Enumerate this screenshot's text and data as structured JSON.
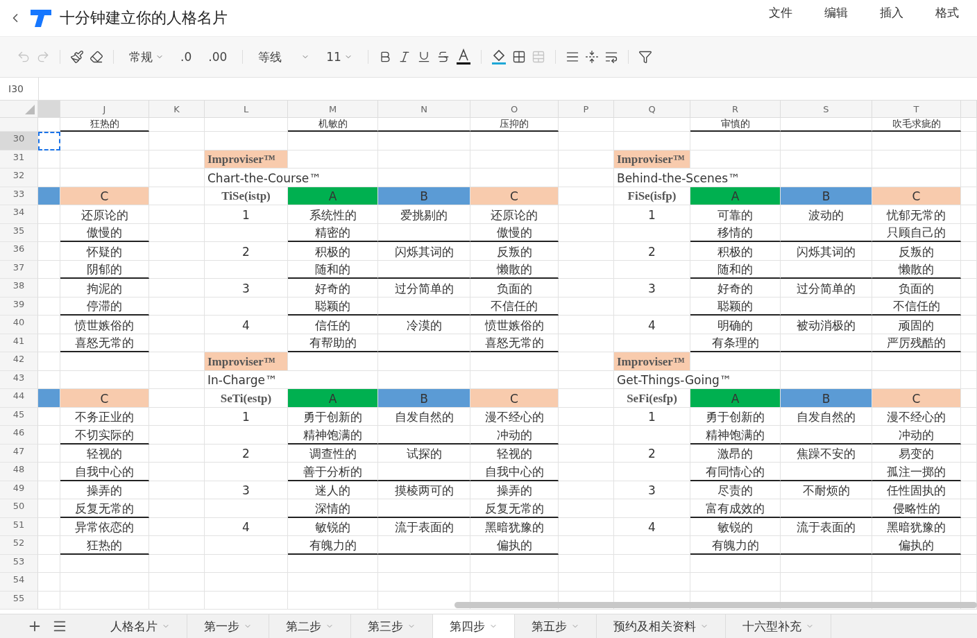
{
  "app": {
    "title": "十分钟建立你的人格名片",
    "menu": [
      {
        "label": "文件"
      },
      {
        "label": "编辑"
      },
      {
        "label": "插入"
      },
      {
        "label": "格式"
      }
    ]
  },
  "toolbar": {
    "number_format": "常规",
    "decrease_decimal": ".0",
    "increase_decimal": ".00",
    "font": "等线",
    "font_size": "11"
  },
  "formula_bar": {
    "cell_ref": "I30"
  },
  "columns": [
    {
      "selected": true
    },
    {
      "label": "J",
      "selected": false
    },
    {
      "label": "K",
      "selected": false
    },
    {
      "label": "L",
      "selected": false
    },
    {
      "label": "M",
      "selected": false
    },
    {
      "label": "N",
      "selected": false
    },
    {
      "label": "O",
      "selected": false
    },
    {
      "label": "P",
      "selected": false
    },
    {
      "label": "Q",
      "selected": false
    },
    {
      "label": "R",
      "selected": false
    },
    {
      "label": "S",
      "selected": false
    },
    {
      "label": "T",
      "selected": false
    },
    {
      "selected": false
    }
  ],
  "rows": [
    {
      "selected": false,
      "divider": true,
      "cells": [
        {
          "kind": "blank"
        },
        {
          "kind": "text",
          "text": "狂热的"
        },
        {
          "kind": "blank"
        },
        {
          "kind": "blank"
        },
        {
          "kind": "text",
          "text": "机敏的"
        },
        {
          "kind": "blank"
        },
        {
          "kind": "text",
          "text": "压抑的"
        },
        {
          "kind": "blank"
        },
        {
          "kind": "blank"
        },
        {
          "kind": "text",
          "text": "审慎的"
        },
        {
          "kind": "blank"
        },
        {
          "kind": "text",
          "text": "吹毛求疵的"
        }
      ]
    },
    {
      "number": "30",
      "selected": true,
      "divider": false,
      "cells": [
        {
          "kind": "blank"
        }
      ]
    },
    {
      "number": "31",
      "selected": false,
      "divider": false,
      "cells": [
        {
          "kind": "blank"
        },
        {
          "kind": "blank"
        },
        {
          "kind": "blank"
        },
        {
          "kind": "title",
          "text": "Improviser™",
          "color": "#f8cbad"
        },
        {
          "kind": "blank"
        },
        {
          "kind": "blank"
        },
        {
          "kind": "blank"
        },
        {
          "kind": "blank"
        },
        {
          "kind": "title",
          "text": "Improviser™",
          "color": "#f8cbad"
        }
      ]
    },
    {
      "number": "32",
      "selected": false,
      "divider": false,
      "cells": [
        {
          "kind": "blank"
        },
        {
          "kind": "blank"
        },
        {
          "kind": "blank"
        },
        {
          "kind": "wide",
          "text": "Chart-the-Course™"
        },
        {
          "kind": "blank"
        },
        {
          "kind": "blank"
        },
        {
          "kind": "blank"
        },
        {
          "kind": "wide",
          "text": "Behind-the-Scenes™"
        }
      ]
    },
    {
      "number": "33",
      "selected": false,
      "divider": false,
      "cells": [
        {
          "kind": "fill",
          "color": "#5b9bd5"
        },
        {
          "kind": "text",
          "text": "C",
          "color": "#f8cbad"
        },
        {
          "kind": "blank"
        },
        {
          "kind": "code",
          "text": "TiSe(istp)"
        },
        {
          "kind": "text",
          "text": "A",
          "color": "#00b050"
        },
        {
          "kind": "text",
          "text": "B",
          "color": "#5b9bd5"
        },
        {
          "kind": "text",
          "text": "C",
          "color": "#f8cbad"
        },
        {
          "kind": "blank"
        },
        {
          "kind": "code",
          "text": "FiSe(isfp)"
        },
        {
          "kind": "text",
          "text": "A",
          "color": "#00b050"
        },
        {
          "kind": "text",
          "text": "B",
          "color": "#5b9bd5"
        },
        {
          "kind": "text",
          "text": "C",
          "color": "#f8cbad"
        }
      ]
    },
    {
      "number": "34",
      "selected": false,
      "divider": false,
      "cells": [
        {
          "kind": "blank"
        },
        {
          "kind": "text",
          "text": "还原论的"
        },
        {
          "kind": "blank"
        },
        {
          "kind": "text",
          "text": "1"
        },
        {
          "kind": "text",
          "text": "系统性的"
        },
        {
          "kind": "text",
          "text": "爱挑剔的"
        },
        {
          "kind": "text",
          "text": "还原论的"
        },
        {
          "kind": "blank"
        },
        {
          "kind": "text",
          "text": "1"
        },
        {
          "kind": "text",
          "text": "可靠的"
        },
        {
          "kind": "text",
          "text": "波动的"
        },
        {
          "kind": "text",
          "text": "忧郁无常的"
        }
      ]
    },
    {
      "number": "35",
      "selected": false,
      "divider": true,
      "cells": [
        {
          "kind": "blank"
        },
        {
          "kind": "text",
          "text": "傲慢的"
        },
        {
          "kind": "blank"
        },
        {
          "kind": "blank"
        },
        {
          "kind": "text",
          "text": "精密的"
        },
        {
          "kind": "blank"
        },
        {
          "kind": "text",
          "text": "傲慢的"
        },
        {
          "kind": "blank"
        },
        {
          "kind": "blank"
        },
        {
          "kind": "text",
          "text": "移情的"
        },
        {
          "kind": "blank"
        },
        {
          "kind": "text",
          "text": "只顾自己的"
        }
      ]
    },
    {
      "number": "36",
      "selected": false,
      "divider": false,
      "cells": [
        {
          "kind": "blank"
        },
        {
          "kind": "text",
          "text": "怀疑的"
        },
        {
          "kind": "blank"
        },
        {
          "kind": "text",
          "text": "2"
        },
        {
          "kind": "text",
          "text": "积极的"
        },
        {
          "kind": "text",
          "text": "闪烁其词的"
        },
        {
          "kind": "text",
          "text": "反叛的"
        },
        {
          "kind": "blank"
        },
        {
          "kind": "text",
          "text": "2"
        },
        {
          "kind": "text",
          "text": "积极的"
        },
        {
          "kind": "text",
          "text": "闪烁其词的"
        },
        {
          "kind": "text",
          "text": "反叛的"
        }
      ]
    },
    {
      "number": "37",
      "selected": false,
      "divider": true,
      "cells": [
        {
          "kind": "blank"
        },
        {
          "kind": "text",
          "text": "阴郁的"
        },
        {
          "kind": "blank"
        },
        {
          "kind": "blank"
        },
        {
          "kind": "text",
          "text": "随和的"
        },
        {
          "kind": "blank"
        },
        {
          "kind": "text",
          "text": "懒散的"
        },
        {
          "kind": "blank"
        },
        {
          "kind": "blank"
        },
        {
          "kind": "text",
          "text": "随和的"
        },
        {
          "kind": "blank"
        },
        {
          "kind": "text",
          "text": "懒散的"
        }
      ]
    },
    {
      "number": "38",
      "selected": false,
      "divider": false,
      "cells": [
        {
          "kind": "blank"
        },
        {
          "kind": "text",
          "text": "拘泥的"
        },
        {
          "kind": "blank"
        },
        {
          "kind": "text",
          "text": "3"
        },
        {
          "kind": "text",
          "text": "好奇的"
        },
        {
          "kind": "text",
          "text": "过分简单的"
        },
        {
          "kind": "text",
          "text": "负面的"
        },
        {
          "kind": "blank"
        },
        {
          "kind": "text",
          "text": "3"
        },
        {
          "kind": "text",
          "text": "好奇的"
        },
        {
          "kind": "text",
          "text": "过分简单的"
        },
        {
          "kind": "text",
          "text": "负面的"
        }
      ]
    },
    {
      "number": "39",
      "selected": false,
      "divider": true,
      "cells": [
        {
          "kind": "blank"
        },
        {
          "kind": "text",
          "text": "停滞的"
        },
        {
          "kind": "blank"
        },
        {
          "kind": "blank"
        },
        {
          "kind": "text",
          "text": "聪颖的"
        },
        {
          "kind": "blank"
        },
        {
          "kind": "text",
          "text": "不信任的"
        },
        {
          "kind": "blank"
        },
        {
          "kind": "blank"
        },
        {
          "kind": "text",
          "text": "聪颖的"
        },
        {
          "kind": "blank"
        },
        {
          "kind": "text",
          "text": "不信任的"
        }
      ]
    },
    {
      "number": "40",
      "selected": false,
      "divider": false,
      "cells": [
        {
          "kind": "blank"
        },
        {
          "kind": "text",
          "text": "愤世嫉俗的"
        },
        {
          "kind": "blank"
        },
        {
          "kind": "text",
          "text": "4"
        },
        {
          "kind": "text",
          "text": "信任的"
        },
        {
          "kind": "text",
          "text": "冷漠的"
        },
        {
          "kind": "text",
          "text": "愤世嫉俗的"
        },
        {
          "kind": "blank"
        },
        {
          "kind": "text",
          "text": "4"
        },
        {
          "kind": "text",
          "text": "明确的"
        },
        {
          "kind": "text",
          "text": "被动消极的"
        },
        {
          "kind": "text",
          "text": "顽固的"
        }
      ]
    },
    {
      "number": "41",
      "selected": false,
      "divider": true,
      "cells": [
        {
          "kind": "blank"
        },
        {
          "kind": "text",
          "text": "喜怒无常的"
        },
        {
          "kind": "blank"
        },
        {
          "kind": "blank"
        },
        {
          "kind": "text",
          "text": "有帮助的"
        },
        {
          "kind": "blank"
        },
        {
          "kind": "text",
          "text": "喜怒无常的"
        },
        {
          "kind": "blank"
        },
        {
          "kind": "blank"
        },
        {
          "kind": "text",
          "text": "有条理的"
        },
        {
          "kind": "blank"
        },
        {
          "kind": "text",
          "text": "严厉残酷的"
        }
      ]
    },
    {
      "number": "42",
      "selected": false,
      "divider": false,
      "cells": [
        {
          "kind": "blank"
        },
        {
          "kind": "blank"
        },
        {
          "kind": "blank"
        },
        {
          "kind": "title",
          "text": "Improviser™",
          "color": "#f8cbad"
        },
        {
          "kind": "blank"
        },
        {
          "kind": "blank"
        },
        {
          "kind": "blank"
        },
        {
          "kind": "blank"
        },
        {
          "kind": "title",
          "text": "Improviser™",
          "color": "#f8cbad"
        }
      ]
    },
    {
      "number": "43",
      "selected": false,
      "divider": false,
      "cells": [
        {
          "kind": "blank"
        },
        {
          "kind": "blank"
        },
        {
          "kind": "blank"
        },
        {
          "kind": "wide",
          "text": "In-Charge™"
        },
        {
          "kind": "blank"
        },
        {
          "kind": "blank"
        },
        {
          "kind": "blank"
        },
        {
          "kind": "wide",
          "text": "Get-Things-Going™"
        }
      ]
    },
    {
      "number": "44",
      "selected": false,
      "divider": false,
      "cells": [
        {
          "kind": "fill",
          "color": "#5b9bd5"
        },
        {
          "kind": "text",
          "text": "C",
          "color": "#f8cbad"
        },
        {
          "kind": "blank"
        },
        {
          "kind": "code",
          "text": "SeTi(estp)"
        },
        {
          "kind": "text",
          "text": "A",
          "color": "#00b050"
        },
        {
          "kind": "text",
          "text": "B",
          "color": "#5b9bd5"
        },
        {
          "kind": "text",
          "text": "C",
          "color": "#f8cbad"
        },
        {
          "kind": "blank"
        },
        {
          "kind": "code",
          "text": "SeFi(esfp)"
        },
        {
          "kind": "text",
          "text": "A",
          "color": "#00b050"
        },
        {
          "kind": "text",
          "text": "B",
          "color": "#5b9bd5"
        },
        {
          "kind": "text",
          "text": "C",
          "color": "#f8cbad"
        }
      ]
    },
    {
      "number": "45",
      "selected": false,
      "divider": false,
      "cells": [
        {
          "kind": "blank"
        },
        {
          "kind": "text",
          "text": "不务正业的"
        },
        {
          "kind": "blank"
        },
        {
          "kind": "text",
          "text": "1"
        },
        {
          "kind": "text",
          "text": "勇于创新的"
        },
        {
          "kind": "text",
          "text": "自发自然的"
        },
        {
          "kind": "text",
          "text": "漫不经心的"
        },
        {
          "kind": "blank"
        },
        {
          "kind": "text",
          "text": "1"
        },
        {
          "kind": "text",
          "text": "勇于创新的"
        },
        {
          "kind": "text",
          "text": "自发自然的"
        },
        {
          "kind": "text",
          "text": "漫不经心的"
        }
      ]
    },
    {
      "number": "46",
      "selected": false,
      "divider": true,
      "cells": [
        {
          "kind": "blank"
        },
        {
          "kind": "text",
          "text": "不切实际的"
        },
        {
          "kind": "blank"
        },
        {
          "kind": "blank"
        },
        {
          "kind": "text",
          "text": "精神饱满的"
        },
        {
          "kind": "blank"
        },
        {
          "kind": "text",
          "text": "冲动的"
        },
        {
          "kind": "blank"
        },
        {
          "kind": "blank"
        },
        {
          "kind": "text",
          "text": "精神饱满的"
        },
        {
          "kind": "blank"
        },
        {
          "kind": "text",
          "text": "冲动的"
        }
      ]
    },
    {
      "number": "47",
      "selected": false,
      "divider": false,
      "cells": [
        {
          "kind": "blank"
        },
        {
          "kind": "text",
          "text": "轻视的"
        },
        {
          "kind": "blank"
        },
        {
          "kind": "text",
          "text": "2"
        },
        {
          "kind": "text",
          "text": "调查性的"
        },
        {
          "kind": "text",
          "text": "试探的"
        },
        {
          "kind": "text",
          "text": "轻视的"
        },
        {
          "kind": "blank"
        },
        {
          "kind": "text",
          "text": "2"
        },
        {
          "kind": "text",
          "text": "激昂的"
        },
        {
          "kind": "text",
          "text": "焦躁不安的"
        },
        {
          "kind": "text",
          "text": "易变的"
        }
      ]
    },
    {
      "number": "48",
      "selected": false,
      "divider": true,
      "cells": [
        {
          "kind": "blank"
        },
        {
          "kind": "text",
          "text": "自我中心的"
        },
        {
          "kind": "blank"
        },
        {
          "kind": "blank"
        },
        {
          "kind": "text",
          "text": "善于分析的"
        },
        {
          "kind": "blank"
        },
        {
          "kind": "text",
          "text": "自我中心的"
        },
        {
          "kind": "blank"
        },
        {
          "kind": "blank"
        },
        {
          "kind": "text",
          "text": "有同情心的"
        },
        {
          "kind": "blank"
        },
        {
          "kind": "text",
          "text": "孤注一掷的"
        }
      ]
    },
    {
      "number": "49",
      "selected": false,
      "divider": false,
      "cells": [
        {
          "kind": "blank"
        },
        {
          "kind": "text",
          "text": "操弄的"
        },
        {
          "kind": "blank"
        },
        {
          "kind": "text",
          "text": "3"
        },
        {
          "kind": "text",
          "text": "迷人的"
        },
        {
          "kind": "text",
          "text": "摸棱两可的"
        },
        {
          "kind": "text",
          "text": "操弄的"
        },
        {
          "kind": "blank"
        },
        {
          "kind": "text",
          "text": "3"
        },
        {
          "kind": "text",
          "text": "尽责的"
        },
        {
          "kind": "text",
          "text": "不耐烦的"
        },
        {
          "kind": "text",
          "text": "任性固执的"
        }
      ]
    },
    {
      "number": "50",
      "selected": false,
      "divider": true,
      "cells": [
        {
          "kind": "blank"
        },
        {
          "kind": "text",
          "text": "反复无常的"
        },
        {
          "kind": "blank"
        },
        {
          "kind": "blank"
        },
        {
          "kind": "text",
          "text": "深情的"
        },
        {
          "kind": "blank"
        },
        {
          "kind": "text",
          "text": "反复无常的"
        },
        {
          "kind": "blank"
        },
        {
          "kind": "blank"
        },
        {
          "kind": "text",
          "text": "富有成效的"
        },
        {
          "kind": "blank"
        },
        {
          "kind": "text",
          "text": "侵略性的"
        }
      ]
    },
    {
      "number": "51",
      "selected": false,
      "divider": false,
      "cells": [
        {
          "kind": "blank"
        },
        {
          "kind": "text",
          "text": "异常依恋的"
        },
        {
          "kind": "blank"
        },
        {
          "kind": "text",
          "text": "4"
        },
        {
          "kind": "text",
          "text": "敏锐的"
        },
        {
          "kind": "text",
          "text": "流于表面的"
        },
        {
          "kind": "text",
          "text": "黑暗犹豫的"
        },
        {
          "kind": "blank"
        },
        {
          "kind": "text",
          "text": "4"
        },
        {
          "kind": "text",
          "text": "敏锐的"
        },
        {
          "kind": "text",
          "text": "流于表面的"
        },
        {
          "kind": "text",
          "text": "黑暗犹豫的"
        }
      ]
    },
    {
      "number": "52",
      "selected": false,
      "divider": true,
      "cells": [
        {
          "kind": "blank"
        },
        {
          "kind": "text",
          "text": "狂热的"
        },
        {
          "kind": "blank"
        },
        {
          "kind": "blank"
        },
        {
          "kind": "text",
          "text": "有魄力的"
        },
        {
          "kind": "blank"
        },
        {
          "kind": "text",
          "text": "偏执的"
        },
        {
          "kind": "blank"
        },
        {
          "kind": "blank"
        },
        {
          "kind": "text",
          "text": "有魄力的"
        },
        {
          "kind": "blank"
        },
        {
          "kind": "text",
          "text": "偏执的"
        }
      ]
    },
    {
      "number": "53",
      "selected": false,
      "divider": false
    },
    {
      "number": "54",
      "selected": false,
      "divider": false
    },
    {
      "number": "55",
      "selected": false,
      "divider": false
    }
  ],
  "sheet_tabs": [
    {
      "label": "人格名片",
      "selected": false
    },
    {
      "label": "第一步",
      "selected": false
    },
    {
      "label": "第二步",
      "selected": false
    },
    {
      "label": "第三步",
      "selected": false
    },
    {
      "label": "第四步",
      "selected": true
    },
    {
      "label": "第五步",
      "selected": false
    },
    {
      "label": "预约及相关资料",
      "selected": false
    },
    {
      "label": "十六型补充",
      "selected": false
    }
  ]
}
